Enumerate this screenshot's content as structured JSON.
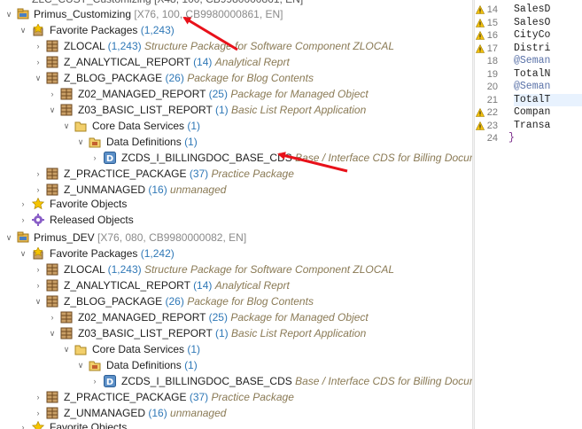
{
  "top_partial": "ZLC_CUST_Customizing [X48, 100, CB9980000861, EN]",
  "project1": {
    "name": "Primus_Customizing",
    "info": "[X76, 100, CB9980000861, EN]",
    "favorites_label": "Favorite Packages",
    "favorites_count": "(1,243)",
    "packages": [
      {
        "name": "ZLOCAL",
        "count": "(1,243)",
        "desc": "Structure Package for Software Component ZLOCAL"
      },
      {
        "name": "Z_ANALYTICAL_REPORT",
        "count": "(14)",
        "desc": "Analytical Reprt"
      },
      {
        "name": "Z_BLOG_PACKAGE",
        "count": "(26)",
        "desc": "Package for Blog Contents"
      },
      {
        "name": "Z02_MANAGED_REPORT",
        "count": "(25)",
        "desc": "Package for Managed Object"
      },
      {
        "name": "Z03_BASIC_LIST_REPORT",
        "count": "(1)",
        "desc": "Basic List Report Application"
      },
      {
        "name": "Core Data Services",
        "count": "(1)",
        "desc": ""
      },
      {
        "name": "Data Definitions",
        "count": "(1)",
        "desc": ""
      },
      {
        "name": "ZCDS_I_BILLINGDOC_BASE_CDS",
        "count": "",
        "desc": "Base / Interface CDS for Billing Document"
      },
      {
        "name": "Z_PRACTICE_PACKAGE",
        "count": "(37)",
        "desc": "Practice Package"
      },
      {
        "name": "Z_UNMANAGED",
        "count": "(16)",
        "desc": "unmanaged"
      }
    ],
    "favorite_objects": "Favorite Objects",
    "released_objects": "Released Objects"
  },
  "project2": {
    "name": "Primus_DEV",
    "info": "[X76, 080, CB9980000082, EN]",
    "favorites_label": "Favorite Packages",
    "favorites_count": "(1,242)",
    "packages": [
      {
        "name": "ZLOCAL",
        "count": "(1,243)",
        "desc": "Structure Package for Software Component ZLOCAL"
      },
      {
        "name": "Z_ANALYTICAL_REPORT",
        "count": "(14)",
        "desc": "Analytical Reprt"
      },
      {
        "name": "Z_BLOG_PACKAGE",
        "count": "(26)",
        "desc": "Package for Blog Contents"
      },
      {
        "name": "Z02_MANAGED_REPORT",
        "count": "(25)",
        "desc": "Package for Managed Object"
      },
      {
        "name": "Z03_BASIC_LIST_REPORT",
        "count": "(1)",
        "desc": "Basic List Report Application"
      },
      {
        "name": "Core Data Services",
        "count": "(1)",
        "desc": ""
      },
      {
        "name": "Data Definitions",
        "count": "(1)",
        "desc": ""
      },
      {
        "name": "ZCDS_I_BILLINGDOC_BASE_CDS",
        "count": "",
        "desc": "Base / Interface CDS for Billing Document"
      },
      {
        "name": "Z_PRACTICE_PACKAGE",
        "count": "(37)",
        "desc": "Practice Package"
      },
      {
        "name": "Z_UNMANAGED",
        "count": "(16)",
        "desc": "unmanaged"
      }
    ],
    "favorite_objects": "Favorite Objects"
  },
  "editor": {
    "lines": [
      {
        "num": "14",
        "code": "SalesD",
        "warn": true
      },
      {
        "num": "15",
        "code": "SalesO",
        "warn": true
      },
      {
        "num": "16",
        "code": "CityCo",
        "warn": true
      },
      {
        "num": "17",
        "code": "Distri",
        "warn": true
      },
      {
        "num": "18",
        "code": "@Seman",
        "warn": false
      },
      {
        "num": "19",
        "code": "TotalN",
        "warn": false
      },
      {
        "num": "20",
        "code": "@Seman",
        "warn": false
      },
      {
        "num": "21",
        "code": "TotalT",
        "warn": false
      },
      {
        "num": "22",
        "code": "Compan",
        "warn": true
      },
      {
        "num": "23",
        "code": "Transa",
        "warn": true
      },
      {
        "num": "24",
        "code": "}",
        "warn": false
      }
    ]
  },
  "colors": {
    "count": "#2f78b7",
    "desc": "#8a7a55",
    "sys": "#8a8a8a",
    "arrow": "#e8111a",
    "annotation": "#3c62c8"
  }
}
